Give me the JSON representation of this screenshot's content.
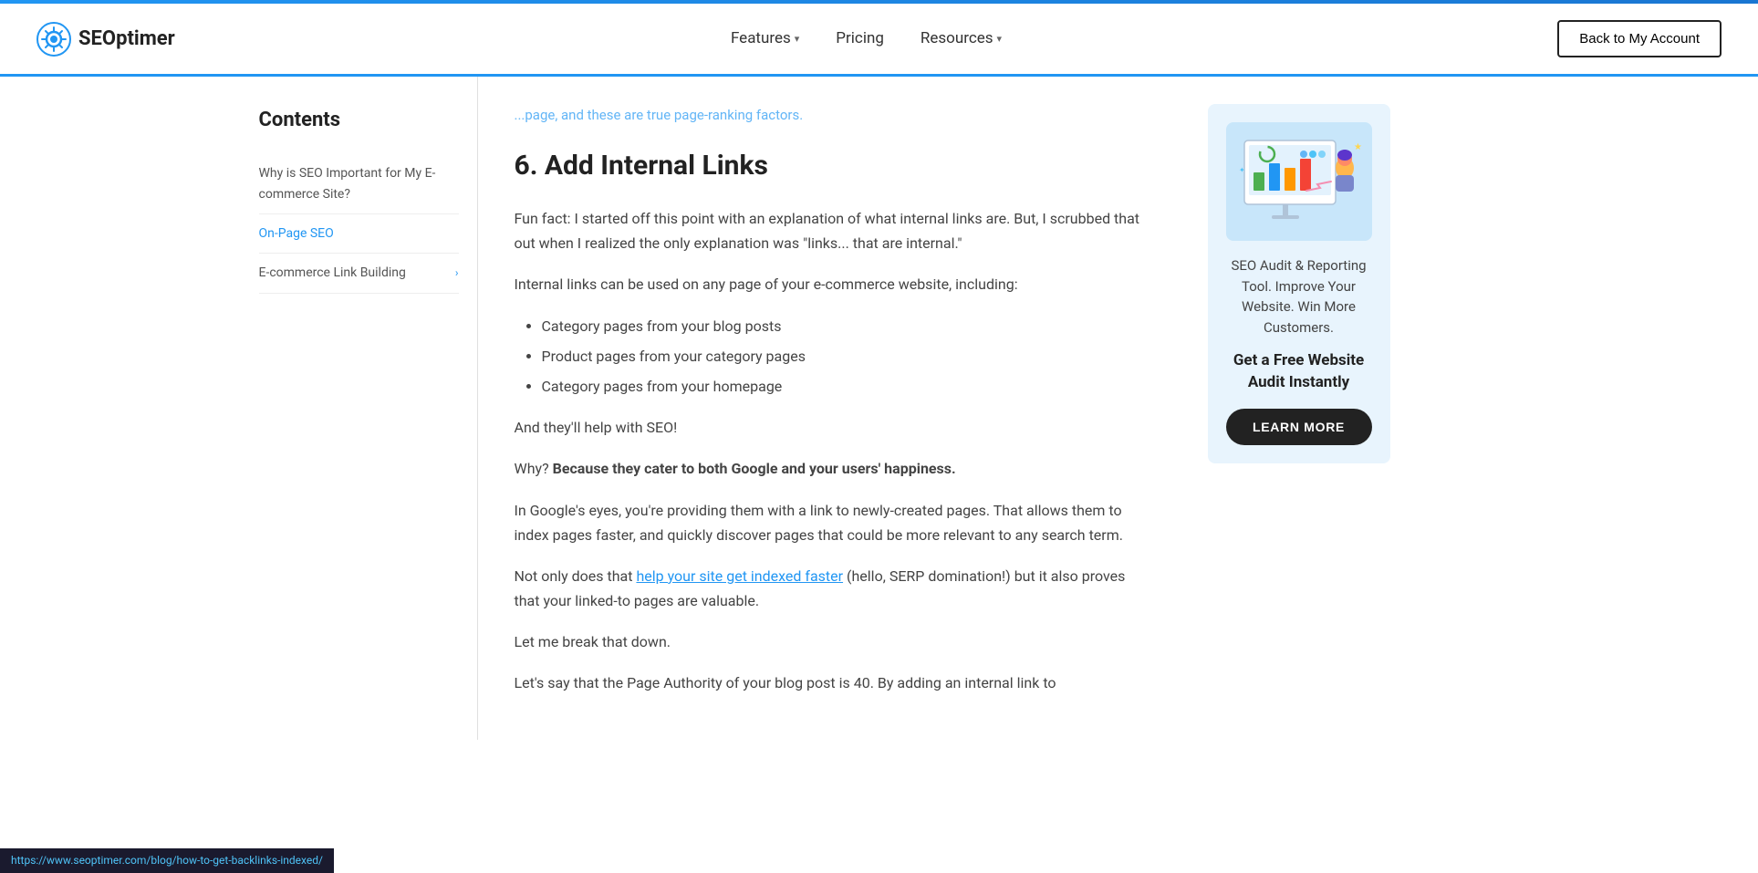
{
  "header": {
    "logo_text": "SEOptimer",
    "nav": {
      "features_label": "Features",
      "pricing_label": "Pricing",
      "resources_label": "Resources"
    },
    "back_button": "Back to My Account"
  },
  "sidebar": {
    "contents_title": "Contents",
    "items": [
      {
        "label": "Why is SEO Important for My E-commerce Site?",
        "active": false,
        "has_arrow": false
      },
      {
        "label": "On-Page SEO",
        "active": true,
        "has_arrow": false
      },
      {
        "label": "E-commerce Link Building",
        "active": false,
        "has_arrow": true
      }
    ]
  },
  "article": {
    "faded_top": "...page, and these are true page-ranking factors.",
    "section_number": "6.",
    "section_title": "Add Internal Links",
    "para1": "Fun fact: I started off this point with an explanation of what internal links are. But, I scrubbed that out when I realized the only explanation was \"links... that are internal.\"",
    "para2": "Internal links can be used on any page of your e-commerce website, including:",
    "bullets": [
      "Category pages from your blog posts",
      "Product pages from your category pages",
      "Category pages from your homepage"
    ],
    "para3": "And they'll help with SEO!",
    "para4_prefix": "Why? ",
    "para4_bold": "Because they cater to both Google and your users' happiness.",
    "para5": "In Google's eyes, you're providing them with a link to newly-created pages. That allows them to index pages faster, and quickly discover pages that could be more relevant to any search term.",
    "para6_prefix": "Not only does that ",
    "para6_link": "help your site get indexed faster",
    "para6_suffix": " (hello, SERP domination!) but it also proves that your linked-to pages are valuable.",
    "para7": "Let me break that down.",
    "para8": "Let's say that the Page Authority of your blog post is 40. By adding an internal link to"
  },
  "cta": {
    "description": "SEO Audit & Reporting Tool. Improve Your Website. Win More Customers.",
    "heading": "Get a Free Website Audit Instantly",
    "button_label": "LEARN MORE"
  },
  "status_bar": {
    "url": "https://www.seoptimer.com/blog/how-to-get-backlinks-indexed/"
  }
}
